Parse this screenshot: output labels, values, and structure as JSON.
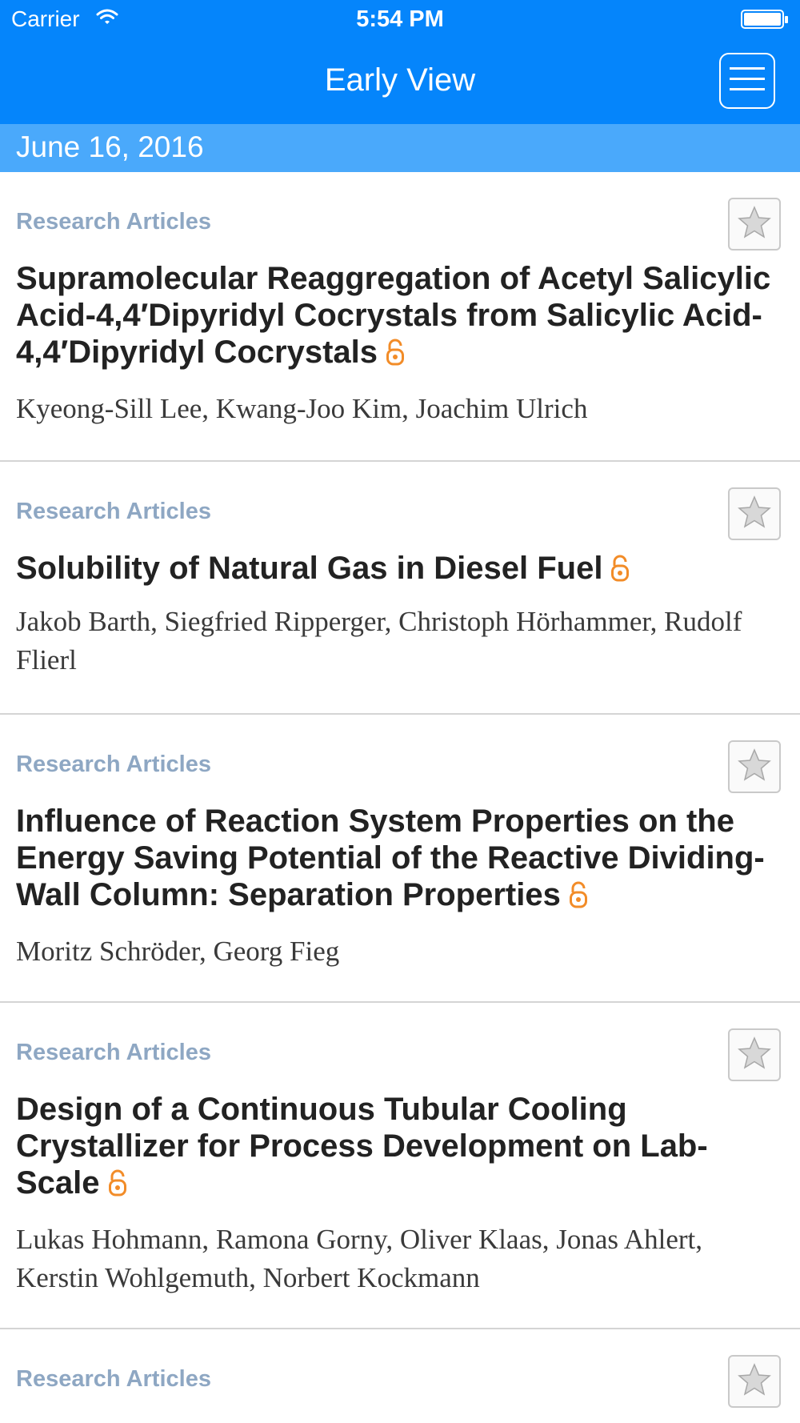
{
  "status_bar": {
    "carrier": "Carrier",
    "time": "5:54 PM"
  },
  "nav": {
    "title": "Early View"
  },
  "date_header": "June 16, 2016",
  "colors": {
    "nav_background": "#0585fb",
    "date_bar_background": "#4aa9fb",
    "category_text": "#8ea7c3",
    "open_access_icon": "#f28c28"
  },
  "articles": [
    {
      "category": "Research Articles",
      "title": "Supramolecular Reaggregation of Acetyl Salicylic Acid-4,4′Dipyridyl Cocrystals from Salicylic Acid-4,4′Dipyridyl Cocrystals",
      "authors": "Kyeong-Sill Lee, Kwang-Joo Kim, Joachim Ulrich",
      "open_access": true
    },
    {
      "category": "Research Articles",
      "title": "Solubility of Natural Gas in Diesel Fuel",
      "authors": "Jakob Barth, Siegfried Ripperger, Christoph Hörhammer, Rudolf Flierl",
      "open_access": true
    },
    {
      "category": "Research Articles",
      "title": "Influence of Reaction System Properties on the Energy Saving Potential of the Reactive Dividing-Wall Column: Separation Properties",
      "authors": "Moritz Schröder, Georg Fieg",
      "open_access": true
    },
    {
      "category": "Research Articles",
      "title": "Design of a Continuous Tubular Cooling Crystallizer for Process Development on Lab-Scale",
      "authors": "Lukas Hohmann, Ramona Gorny, Oliver Klaas, Jonas Ahlert, Kerstin Wohlgemuth, Norbert Kockmann",
      "open_access": true
    },
    {
      "category": "Research Articles"
    }
  ]
}
